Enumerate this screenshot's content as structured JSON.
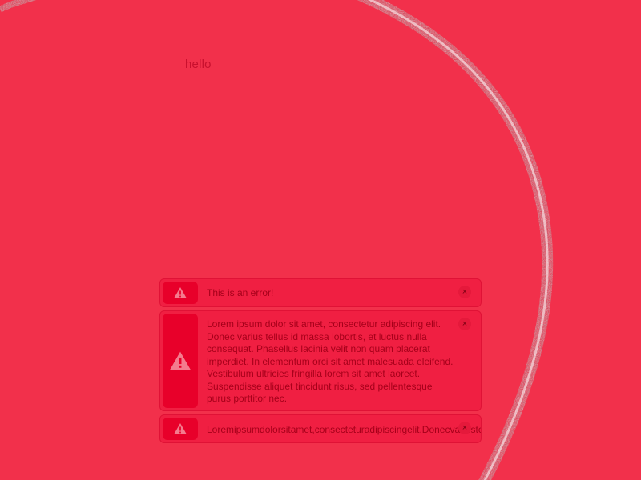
{
  "page": {
    "greeting": "hello",
    "background_color": "#f2304b"
  },
  "toasts": [
    {
      "icon": "warning-icon",
      "message": "This is an error!",
      "close_icon": "close-icon",
      "close_glyph": "×"
    },
    {
      "icon": "warning-icon",
      "message": "Lorem ipsum dolor sit amet, consectetur adipiscing elit. Donec varius tellus id massa lobortis, et luctus nulla consequat. Phasellus lacinia velit non quam placerat imperdiet. In elementum orci sit amet malesuada eleifend. Vestibulum ultricies fringilla lorem sit amet laoreet. Suspendisse aliquet tincidunt risus, sed pellentesque purus porttitor nec.",
      "close_icon": "close-icon",
      "close_glyph": "×"
    },
    {
      "icon": "warning-icon",
      "message": "Loremipsumdolorsitamet,consecteturadipiscingelit.Donecvariustellusidmassalobortis",
      "close_icon": "close-icon",
      "close_glyph": "×"
    }
  ],
  "colors": {
    "toast_bg": "#f01f42",
    "icon_box": "#e8002a",
    "text": "#a6001a"
  }
}
